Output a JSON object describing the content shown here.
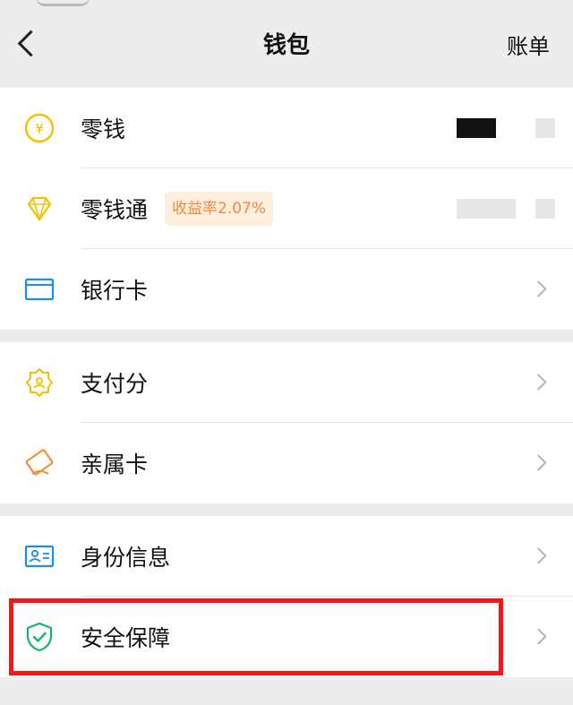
{
  "navbar": {
    "back_icon": "chevron-left-icon",
    "title": "钱包",
    "right_action": "账单"
  },
  "groups": [
    {
      "items": [
        {
          "id": "lingqian",
          "label": "零钱",
          "icon": "yen-coin-icon",
          "value_redacted": true
        },
        {
          "id": "lingqiantong",
          "label": "零钱通",
          "icon": "diamond-icon",
          "badge": "收益率2.07%",
          "value_redacted": true
        },
        {
          "id": "bankcard",
          "label": "银行卡",
          "icon": "bank-card-icon"
        }
      ]
    },
    {
      "items": [
        {
          "id": "payscore",
          "label": "支付分",
          "icon": "pay-score-icon"
        },
        {
          "id": "familycard",
          "label": "亲属卡",
          "icon": "family-card-icon"
        }
      ]
    },
    {
      "items": [
        {
          "id": "identity",
          "label": "身份信息",
          "icon": "id-card-icon"
        },
        {
          "id": "security",
          "label": "安全保障",
          "icon": "shield-check-icon",
          "highlighted": true
        }
      ]
    }
  ],
  "colors": {
    "background": "#ededed",
    "yellow_icon": "#f5c000",
    "blue_icon": "#1b8ee8",
    "orange_icon": "#f0913a",
    "green_icon": "#18b56a",
    "badge_text": "#f08b3a",
    "badge_bg": "#fdeede",
    "highlight_border": "#f01818"
  }
}
